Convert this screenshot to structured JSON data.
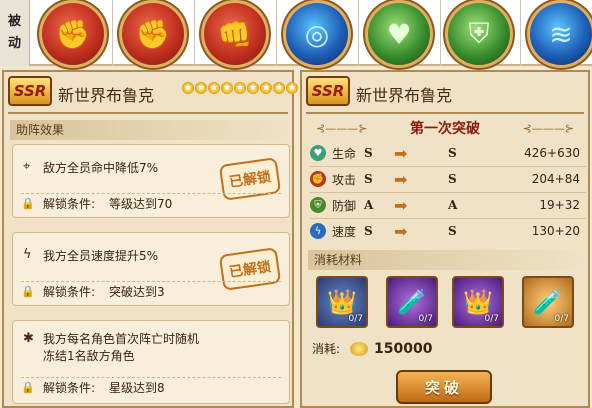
{
  "skills": {
    "passive_label_1": "被",
    "passive_label_2": "动",
    "icons": [
      {
        "name": "fist-icon",
        "color": "red"
      },
      {
        "name": "fist-icon",
        "color": "red"
      },
      {
        "name": "punch-icon",
        "color": "red"
      },
      {
        "name": "target-icon",
        "color": "blue"
      },
      {
        "name": "heart-body-icon",
        "color": "green"
      },
      {
        "name": "shield-body-icon",
        "color": "green"
      },
      {
        "name": "wind-icon",
        "color": "blue"
      }
    ]
  },
  "left_panel": {
    "rarity": "SSR",
    "hero_name": "新世界布鲁克",
    "star_count": 9,
    "section_title": "助阵效果",
    "effects": [
      {
        "icon": "crosshair-icon",
        "text": "敌方全员命中降低7%",
        "cond_label": "解锁条件:",
        "cond_value": "等级达到70",
        "stamp": "已解锁"
      },
      {
        "icon": "lightning-icon",
        "text": "我方全员速度提升5%",
        "cond_label": "解锁条件:",
        "cond_value": "突破达到3",
        "stamp": "已解锁"
      },
      {
        "icon": "spider-icon",
        "text_line1": "我方每名角色首次阵亡时随机",
        "text_line2": "冻结1名敌方角色",
        "cond_label": "解锁条件:",
        "cond_value": "星级达到8"
      }
    ]
  },
  "right_panel": {
    "rarity": "SSR",
    "hero_name": "新世界布鲁克",
    "breakthrough_title": "第一次突破",
    "stats": [
      {
        "name": "生命",
        "from": "S",
        "to": "S",
        "value": "426+630",
        "color": "#3aa07a",
        "icon": "heart-icon"
      },
      {
        "name": "攻击",
        "from": "S",
        "to": "S",
        "value": "204+84",
        "color": "#c0301f",
        "icon": "fist-icon"
      },
      {
        "name": "防御",
        "from": "A",
        "to": "A",
        "value": "19+32",
        "color": "#4a8a2a",
        "icon": "shield-icon"
      },
      {
        "name": "速度",
        "from": "S",
        "to": "S",
        "value": "130+20",
        "color": "#2a6ac0",
        "icon": "lightning-icon"
      }
    ],
    "materials_title": "消耗材料",
    "materials": [
      {
        "name": "crown-icon",
        "color": "blue",
        "count": "0/7"
      },
      {
        "name": "potion-icon",
        "color": "purple",
        "count": "0/7"
      },
      {
        "name": "crown-icon",
        "color": "purple",
        "count": "0/7"
      },
      {
        "name": "potion-icon",
        "color": "orange",
        "count": "0/7"
      }
    ],
    "cost_label": "消耗:",
    "cost_value": "150000",
    "button_label": "突破"
  }
}
